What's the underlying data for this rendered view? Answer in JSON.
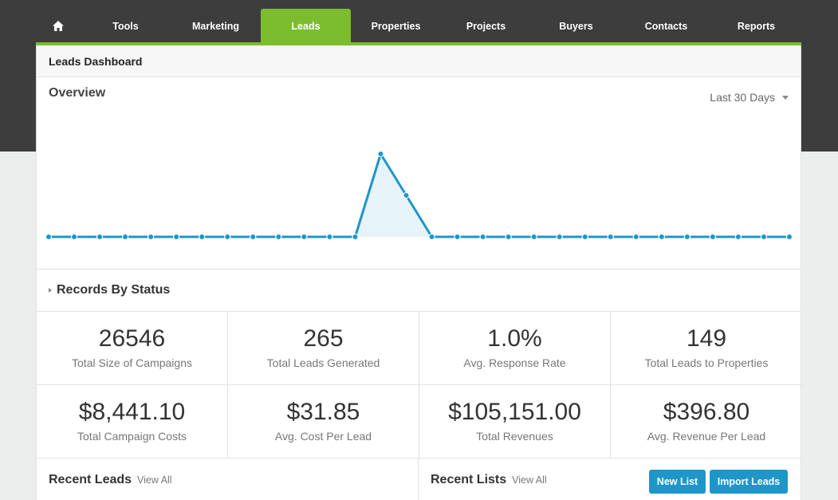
{
  "nav": {
    "items": [
      {
        "label": "Tools"
      },
      {
        "label": "Marketing"
      },
      {
        "label": "Leads",
        "active": true
      },
      {
        "label": "Properties"
      },
      {
        "label": "Projects"
      },
      {
        "label": "Buyers"
      },
      {
        "label": "Contacts"
      },
      {
        "label": "Reports"
      }
    ]
  },
  "dashboard": {
    "title": "Leads Dashboard"
  },
  "overview": {
    "title": "Overview",
    "range_label": "Last 30 Days",
    "colors": {
      "line": "#1e96c8",
      "fill": "#e6f3f9"
    }
  },
  "chart_data": {
    "type": "area",
    "x": [
      1,
      2,
      3,
      4,
      5,
      6,
      7,
      8,
      9,
      10,
      11,
      12,
      13,
      14,
      15,
      16,
      17,
      18,
      19,
      20,
      21,
      22,
      23,
      24,
      25,
      26,
      27,
      28,
      29,
      30
    ],
    "values": [
      0,
      0,
      0,
      0,
      0,
      0,
      0,
      0,
      0,
      0,
      0,
      0,
      0,
      260,
      130,
      0,
      0,
      0,
      0,
      0,
      0,
      0,
      0,
      0,
      0,
      0,
      0,
      0,
      0,
      0
    ],
    "ylim": [
      0,
      280
    ],
    "grid": false
  },
  "records": {
    "title": "Records By Status"
  },
  "stats": [
    {
      "value": "26546",
      "label": "Total Size of Campaigns"
    },
    {
      "value": "265",
      "label": "Total Leads Generated"
    },
    {
      "value": "1.0%",
      "label": "Avg. Response Rate"
    },
    {
      "value": "149",
      "label": "Total Leads to Properties"
    },
    {
      "value": "$8,441.10",
      "label": "Total Campaign Costs"
    },
    {
      "value": "$31.85",
      "label": "Avg. Cost Per Lead"
    },
    {
      "value": "$105,151.00",
      "label": "Total Revenues"
    },
    {
      "value": "$396.80",
      "label": "Avg. Revenue Per Lead"
    }
  ],
  "recent_leads": {
    "title": "Recent Leads",
    "view_all": "View All"
  },
  "recent_lists": {
    "title": "Recent Lists",
    "view_all": "View All",
    "new_list": "New List",
    "import_leads": "Import Leads"
  }
}
